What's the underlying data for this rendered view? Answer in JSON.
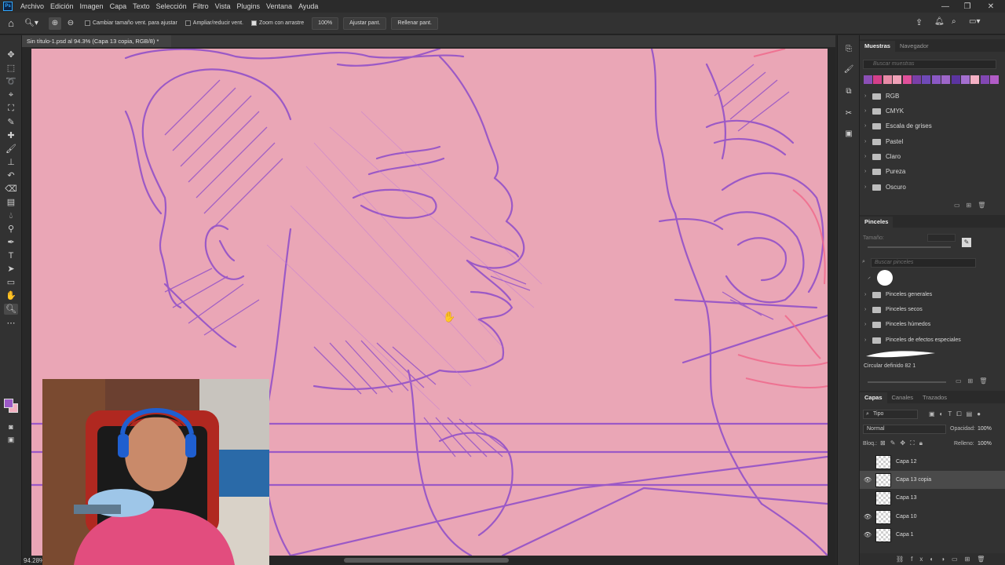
{
  "menubar": {
    "logo": "Ps",
    "items": [
      "Archivo",
      "Edición",
      "Imagen",
      "Capa",
      "Texto",
      "Selección",
      "Filtro",
      "Vista",
      "Plugins",
      "Ventana",
      "Ayuda"
    ]
  },
  "options": {
    "resize_windows": "Cambiar tamaño vent. para ajustar",
    "zoom_all": "Ampliar/reducir vent.",
    "scrubby_zoom": "Zoom con arrastre",
    "zoom_value": "100%",
    "fit_screen": "Ajustar pant.",
    "fill_screen": "Rellenar pant."
  },
  "document": {
    "tab_title": "Sin título-1.psd al 94.3% (Capa 13 copia, RGB/8) *",
    "zoom_status": "94.28%"
  },
  "colors": {
    "canvas_bg": "#eaa6b6",
    "sketch_stroke": "#9b59c6",
    "foreground": "#9b59c6",
    "background": "#f2b0c0"
  },
  "swatches_panel": {
    "tab_active": "Muestras",
    "tab_other": "Navegador",
    "search_placeholder": "Buscar muestras",
    "swatch_colors": [
      "#8b4fb6",
      "#d43f8a",
      "#e78aa6",
      "#f0a1b8",
      "#e0509a",
      "#7a3fa8",
      "#6f4ab8",
      "#8a58c4",
      "#9d66c9",
      "#5b34a0",
      "#a46fd0",
      "#f4b0c4",
      "#8247b3",
      "#b15cc7"
    ],
    "folders": [
      "RGB",
      "CMYK",
      "Escala de grises",
      "Pastel",
      "Claro",
      "Pureza",
      "Oscuro"
    ]
  },
  "brushes_panel": {
    "title": "Pinceles",
    "size_label": "Tamaño:",
    "search_placeholder": "Buscar pinceles",
    "folders": [
      "Pinceles generales",
      "Pinceles secos",
      "Pinceles húmedos",
      "Pinceles de efectos especiales"
    ],
    "selected_brush": "Circular definido 82 1"
  },
  "layers_panel": {
    "tabs": [
      "Capas",
      "Canales",
      "Trazados"
    ],
    "filter": "Tipo",
    "blend_mode": "Normal",
    "opacity_label": "Opacidad:",
    "opacity_value": "100%",
    "lock_label": "Bloq.:",
    "fill_label": "Relleno:",
    "fill_value": "100%",
    "layers": [
      {
        "name": "Capa 12",
        "visible": false,
        "selected": false
      },
      {
        "name": "Capa 13 copia",
        "visible": true,
        "selected": true
      },
      {
        "name": "Capa 13",
        "visible": false,
        "selected": false
      },
      {
        "name": "Capa 10",
        "visible": true,
        "selected": false
      },
      {
        "name": "Capa 1",
        "visible": true,
        "selected": false
      }
    ]
  },
  "icons": {
    "home": "⌂",
    "zoom": "🔍",
    "eye": "👁"
  }
}
